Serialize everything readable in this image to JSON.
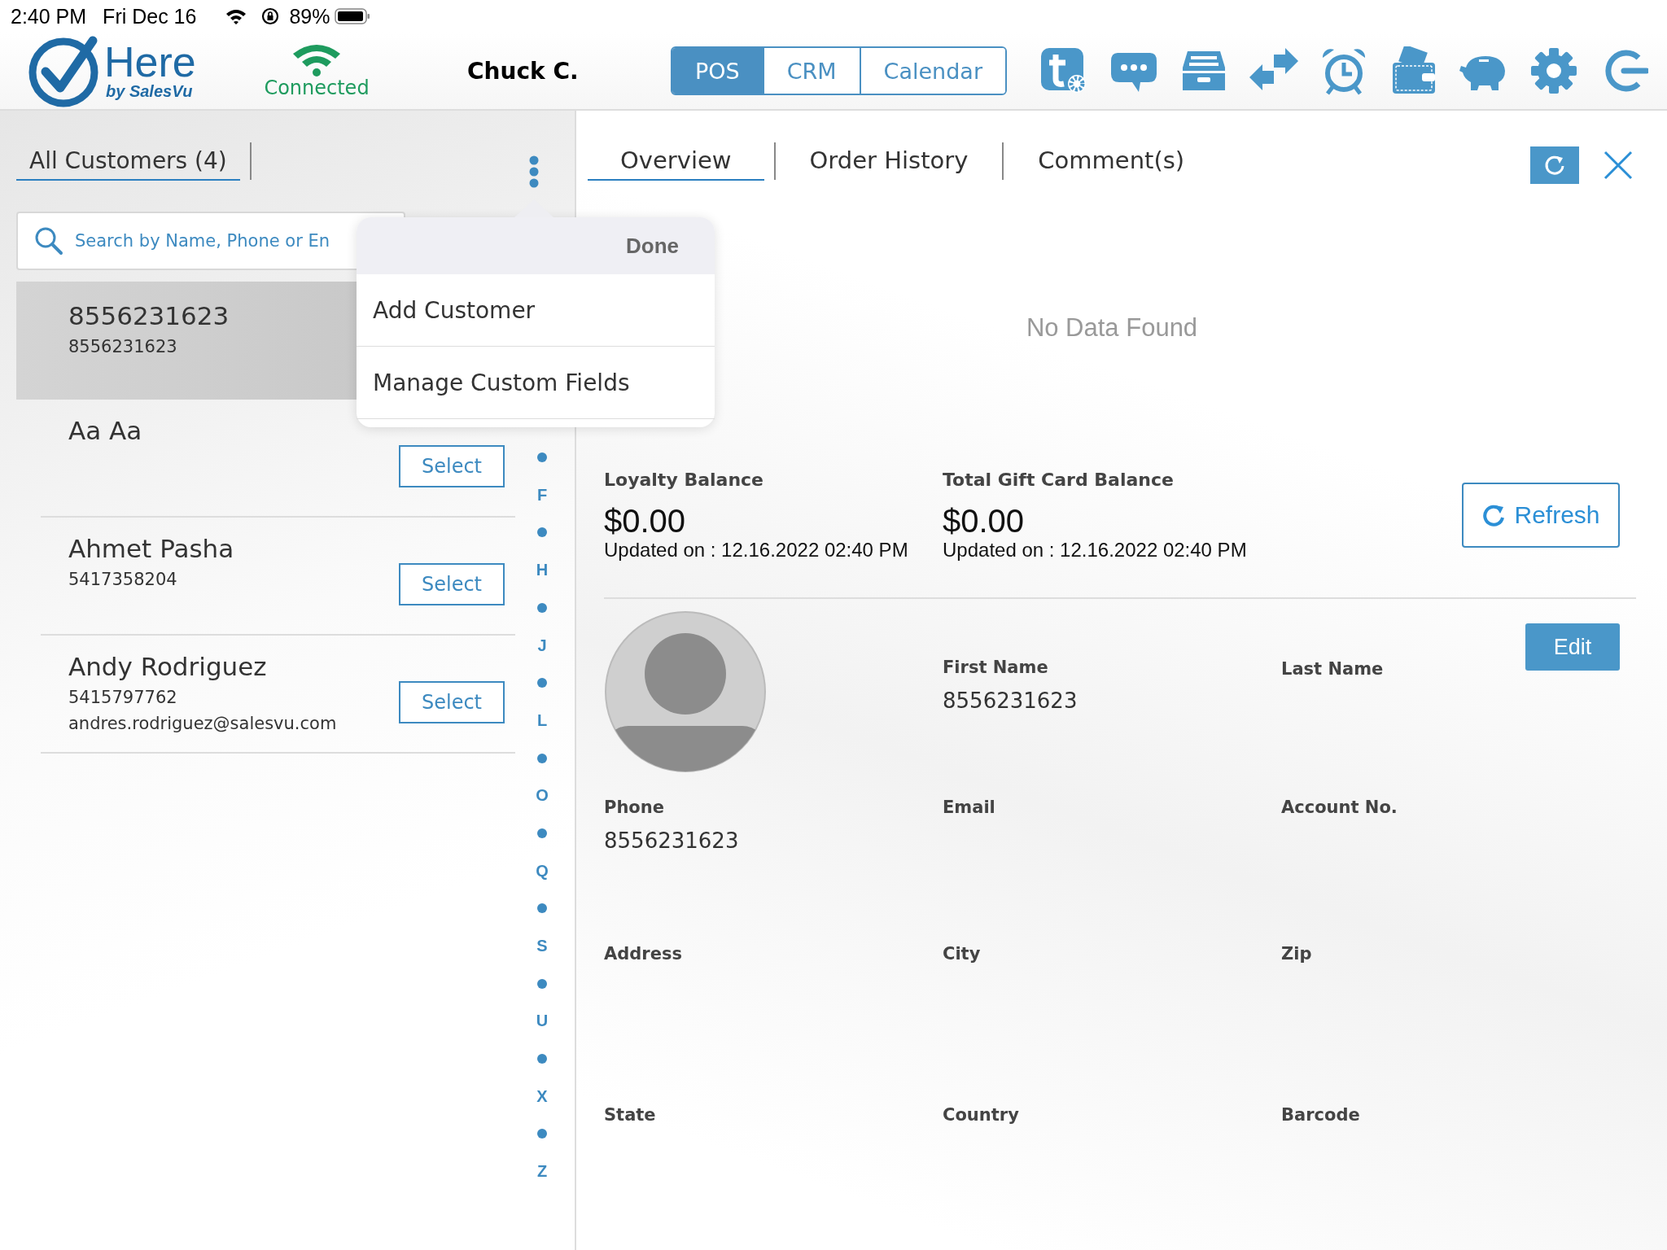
{
  "status_bar": {
    "time": "2:40 PM",
    "date": "Fri Dec 16",
    "battery": "89%"
  },
  "header": {
    "logo": {
      "title": "Here",
      "subtitle": "by SalesVu"
    },
    "connection": "Connected",
    "user": "Chuck C.",
    "modes": [
      {
        "label": "POS",
        "selected": true
      },
      {
        "label": "CRM",
        "selected": false
      },
      {
        "label": "Calendar",
        "selected": false
      }
    ]
  },
  "customers_panel": {
    "tabs": [
      {
        "label": "All Customers (4)",
        "selected": true
      }
    ],
    "search": {
      "placeholder": "Search by Name, Phone or En"
    },
    "customers": [
      {
        "name": "8556231623",
        "phone": "8556231623",
        "selected": true
      },
      {
        "name": "Aa Aa",
        "action": "Select",
        "selected": false
      },
      {
        "name": "Ahmet Pasha",
        "phone": "5417358204",
        "action": "Select",
        "selected": false
      },
      {
        "name": "Andy Rodriguez",
        "phone": "5415797762",
        "email": "andres.rodriguez@salesvu.com",
        "action": "Select",
        "selected": false
      }
    ],
    "index": [
      {
        "kind": "dot"
      },
      {
        "kind": "letter",
        "label": "F"
      },
      {
        "kind": "dot"
      },
      {
        "kind": "letter",
        "label": "H"
      },
      {
        "kind": "dot"
      },
      {
        "kind": "letter",
        "label": "J"
      },
      {
        "kind": "dot"
      },
      {
        "kind": "letter",
        "label": "L"
      },
      {
        "kind": "dot"
      },
      {
        "kind": "letter",
        "label": "O"
      },
      {
        "kind": "dot"
      },
      {
        "kind": "letter",
        "label": "Q"
      },
      {
        "kind": "dot"
      },
      {
        "kind": "letter",
        "label": "S"
      },
      {
        "kind": "dot"
      },
      {
        "kind": "letter",
        "label": "U"
      },
      {
        "kind": "dot"
      },
      {
        "kind": "letter",
        "label": "X"
      },
      {
        "kind": "dot"
      },
      {
        "kind": "letter",
        "label": "Z"
      }
    ]
  },
  "popup_menu": {
    "done": "Done",
    "items": [
      "Add Customer",
      "Manage Custom Fields"
    ]
  },
  "details": {
    "tabs": [
      {
        "label": "Overview",
        "selected": true
      },
      {
        "label": "Order History",
        "selected": false
      },
      {
        "label": "Comment(s)",
        "selected": false
      }
    ],
    "empty_message": "No Data Found",
    "balances": [
      {
        "label": "Loyalty Balance",
        "amount": "$0.00",
        "updated": "Updated on : 12.16.2022 02:40 PM"
      },
      {
        "label": "Total Gift Card Balance",
        "amount": "$0.00",
        "updated": "Updated on : 12.16.2022 02:40 PM"
      }
    ],
    "refresh": "Refresh",
    "edit": "Edit",
    "fields": [
      {
        "label": "First Name",
        "value": "8556231623"
      },
      {
        "label": "Last Name"
      },
      {
        "label": "Phone",
        "value": "8556231623"
      },
      {
        "label": "Email"
      },
      {
        "label": "Account No."
      },
      {
        "label": "Address"
      },
      {
        "label": "City"
      },
      {
        "label": "Zip"
      },
      {
        "label": "State"
      },
      {
        "label": "Country"
      },
      {
        "label": "Barcode"
      }
    ]
  }
}
